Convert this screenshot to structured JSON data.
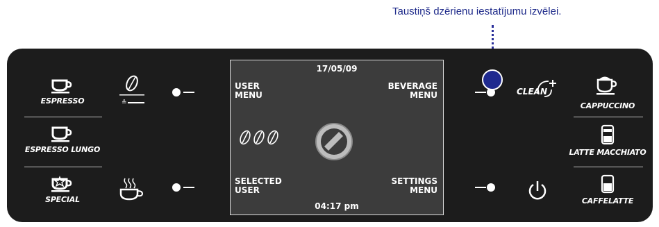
{
  "callout": {
    "text": "Taustiņš dzērienu iestatījumu izvēlei."
  },
  "left_buttons": [
    {
      "label": "ESPRESSO"
    },
    {
      "label": "ESPRESSO LUNGO"
    },
    {
      "label": "SPECIAL"
    }
  ],
  "right_buttons": [
    {
      "label": "CAPPUCCINO"
    },
    {
      "label": "LATTE MACCHIATO"
    },
    {
      "label": "CAFFELATTE"
    }
  ],
  "clean": {
    "label": "CLEAN"
  },
  "screen": {
    "date": "17/05/09",
    "time": "04:17 pm",
    "top_left": {
      "line1": "USER",
      "line2": "MENU"
    },
    "top_right": {
      "line1": "BEVERAGE",
      "line2": "MENU"
    },
    "bottom_left": {
      "line1": "SELECTED",
      "line2": "USER"
    },
    "bottom_right": {
      "line1": "SETTINGS",
      "line2": "MENU"
    }
  },
  "colors": {
    "panel": "#1c1c1c",
    "screen": "#3c3c3c",
    "callout": "#1e2a8a",
    "highlight": "#1f2a8f"
  }
}
